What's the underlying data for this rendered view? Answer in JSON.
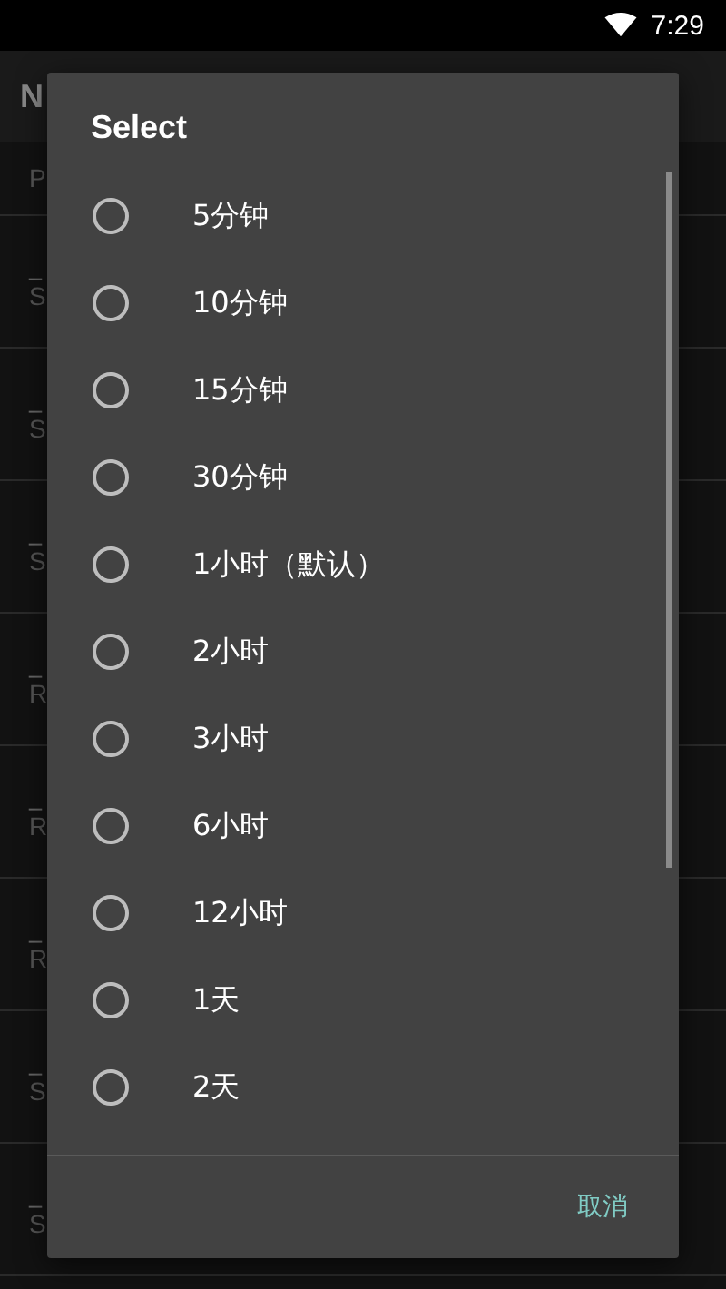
{
  "status_bar": {
    "time": "7:29"
  },
  "background": {
    "title": "N",
    "subtitle": "P",
    "rows": [
      {
        "title": "_",
        "subtitle": "S"
      },
      {
        "title": "_",
        "subtitle": "S"
      },
      {
        "title": "_",
        "subtitle": "S"
      },
      {
        "title": "_",
        "subtitle": "R"
      },
      {
        "title": "_",
        "subtitle": "R"
      },
      {
        "title": "_",
        "subtitle": "R"
      },
      {
        "title": "_",
        "subtitle": "S"
      },
      {
        "title": "_",
        "subtitle": "S"
      }
    ]
  },
  "dialog": {
    "title": "Select",
    "options": [
      {
        "label": "5分钟",
        "selected": false
      },
      {
        "label": "10分钟",
        "selected": false
      },
      {
        "label": "15分钟",
        "selected": false
      },
      {
        "label": "30分钟",
        "selected": false
      },
      {
        "label": "1小时（默认）",
        "selected": false
      },
      {
        "label": "2小时",
        "selected": false
      },
      {
        "label": "3小时",
        "selected": false
      },
      {
        "label": "6小时",
        "selected": false
      },
      {
        "label": "12小时",
        "selected": false
      },
      {
        "label": "1天",
        "selected": false
      },
      {
        "label": "2天",
        "selected": false
      }
    ],
    "cancel": "取消"
  }
}
